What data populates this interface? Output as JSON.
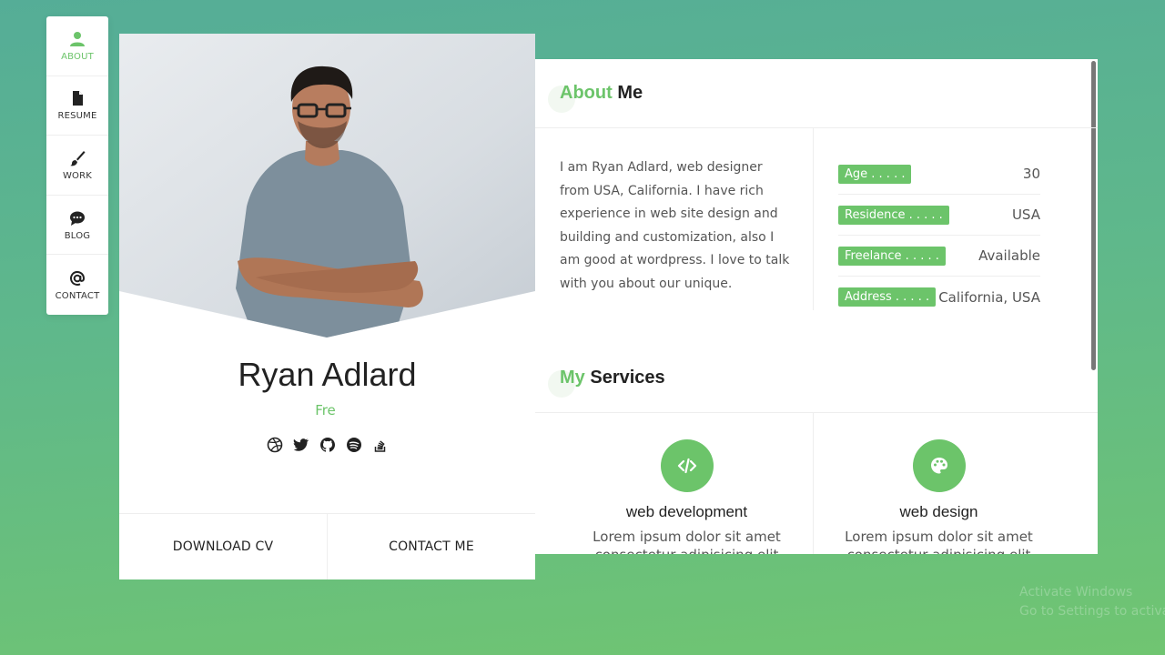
{
  "nav": {
    "items": [
      {
        "label": "ABOUT",
        "icon": "user-icon",
        "active": true
      },
      {
        "label": "RESUME",
        "icon": "document-icon",
        "active": false
      },
      {
        "label": "WORK",
        "icon": "brush-icon",
        "active": false
      },
      {
        "label": "BLOG",
        "icon": "chat-icon",
        "active": false
      },
      {
        "label": "CONTACT",
        "icon": "at-icon",
        "active": false
      }
    ]
  },
  "profile": {
    "name": "Ryan Adlard",
    "role": "Fre",
    "socials": [
      "dribbble-icon",
      "twitter-icon",
      "github-icon",
      "spotify-icon",
      "stackoverflow-icon"
    ],
    "download_cv": "DOWNLOAD CV",
    "contact_me": "CONTACT ME"
  },
  "about": {
    "title_accent": "About",
    "title_rest": "Me",
    "text": "I am Ryan Adlard, web designer from USA, California. I have rich experience in web site design and building and customization, also I am good at wordpress. I love to talk with you about our unique.",
    "info": [
      {
        "label": "Age . . . . .",
        "value": "30"
      },
      {
        "label": "Residence . . . . .",
        "value": "USA"
      },
      {
        "label": "Freelance . . . . .",
        "value": "Available"
      },
      {
        "label": "Address . . . . .",
        "value": "California, USA"
      }
    ]
  },
  "services": {
    "title_accent": "My",
    "title_rest": "Services",
    "items": [
      {
        "icon": "code-icon",
        "title": "web development",
        "desc": "Lorem ipsum dolor sit amet",
        "desc2": "consectetur adipisicing elit"
      },
      {
        "icon": "palette-icon",
        "title": "web design",
        "desc": "Lorem ipsum dolor sit amet",
        "desc2": "consectetur adipisicing elit"
      }
    ]
  },
  "watermark": {
    "line1": "Activate Windows",
    "line2": "Go to Settings to activate Windows."
  },
  "colors": {
    "accent": "#6cc46a",
    "background_top": "#55ad97",
    "background_bottom": "#70c571"
  }
}
